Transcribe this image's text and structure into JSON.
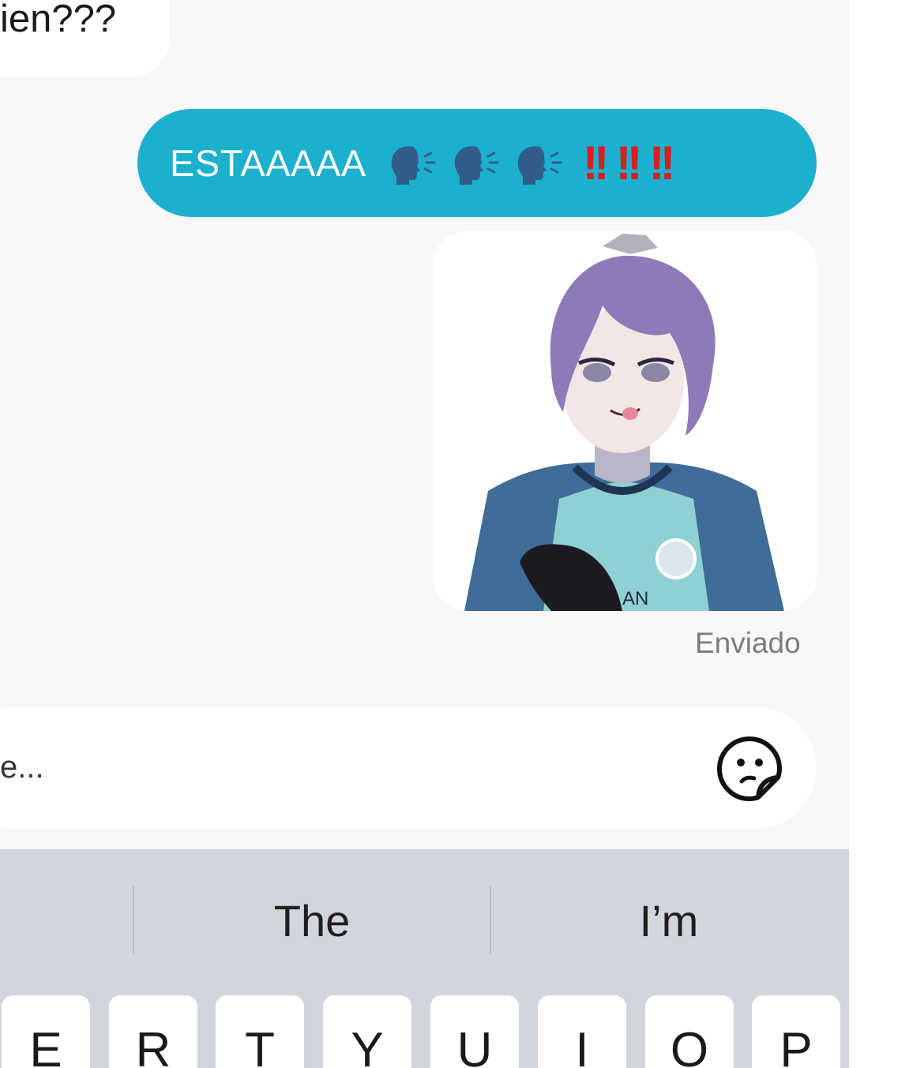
{
  "messages": {
    "incoming_text": "ien???",
    "outgoing_text": "ESTAAAAA",
    "outgoing_emojis": [
      "speaking-head-icon",
      "speaking-head-icon",
      "speaking-head-icon",
      "double-exclamation-icon",
      "double-exclamation-icon",
      "double-exclamation-icon"
    ],
    "outgoing_bang": "!!",
    "sticker_text": "AN",
    "status": "Enviado"
  },
  "composer": {
    "placeholder": "e..."
  },
  "keyboard": {
    "suggestions": [
      "",
      "The",
      "I’m"
    ],
    "keys": [
      "E",
      "R",
      "T",
      "Y",
      "U",
      "I",
      "O",
      "P"
    ]
  },
  "colors": {
    "outgoing_bubble": "#1cb0cf",
    "bang": "#d42020",
    "keyboard_bg": "#d3d5dc"
  }
}
